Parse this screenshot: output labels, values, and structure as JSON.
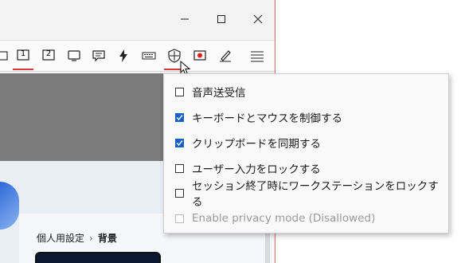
{
  "window": {
    "controls": [
      "minimize-icon",
      "maximize-icon",
      "close-icon"
    ]
  },
  "toolbar": {
    "buttons": [
      {
        "name": "monitor-1",
        "label": "1"
      },
      {
        "name": "monitor-2",
        "label": "2"
      },
      {
        "name": "display-icon"
      },
      {
        "name": "chat-icon"
      },
      {
        "name": "lightning-icon"
      },
      {
        "name": "keyboard-icon"
      },
      {
        "name": "shield-icon"
      },
      {
        "name": "record-icon"
      },
      {
        "name": "pen-icon"
      },
      {
        "name": "menu-icon"
      }
    ]
  },
  "remote": {
    "breadcrumb": {
      "parent": "個人用設定",
      "separator": "›",
      "current": "背景"
    }
  },
  "menu": {
    "items": [
      {
        "label": "音声送受信",
        "checked": false,
        "disabled": false
      },
      {
        "label": "キーボードとマウスを制御する",
        "checked": true,
        "disabled": false
      },
      {
        "label": "クリップボードを同期する",
        "checked": true,
        "disabled": false
      },
      {
        "label": "ユーザー入力をロックする",
        "checked": false,
        "disabled": false
      },
      {
        "label": "セッション終了時にワークステーションをロックする",
        "checked": false,
        "disabled": false
      },
      {
        "label": "Enable privacy mode (Disallowed)",
        "checked": false,
        "disabled": true
      }
    ]
  },
  "colors": {
    "accent": "#1661c9",
    "active_underline": "#d83a3a",
    "window_border": "#e06a6a"
  }
}
